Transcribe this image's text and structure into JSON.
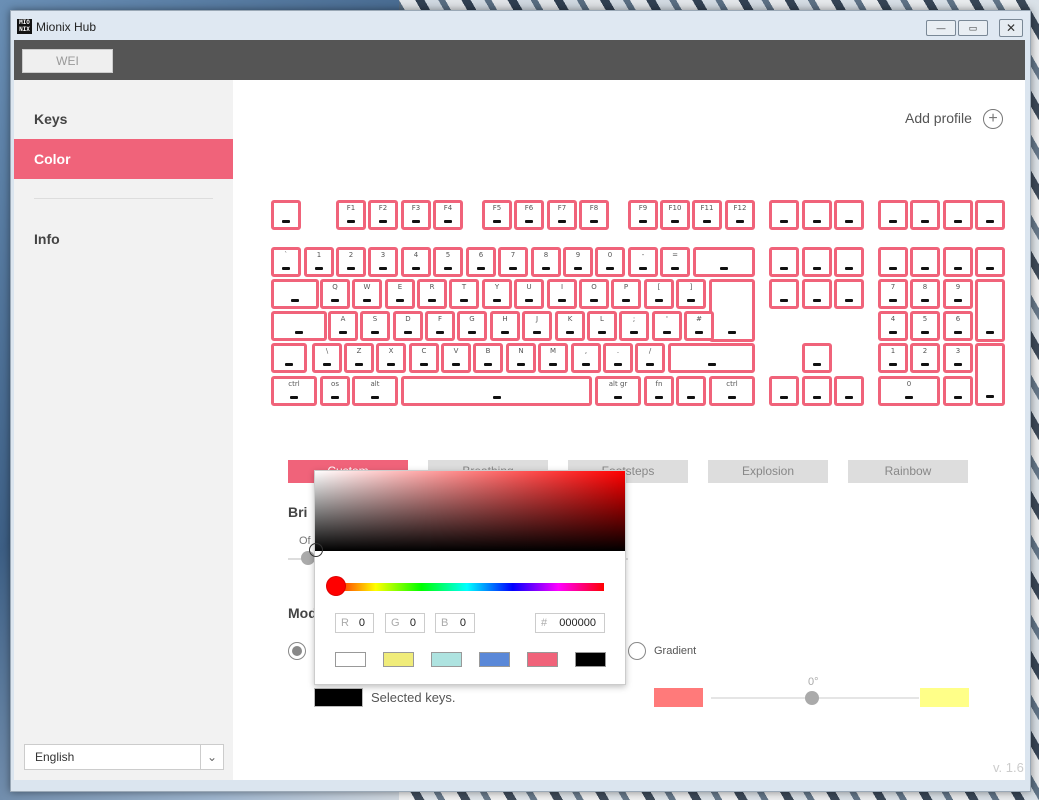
{
  "window": {
    "title": "Mionix Hub",
    "logo_text": "MIO NIX"
  },
  "toolbar": {
    "profile_tab": "WEI"
  },
  "sidebar": {
    "items": [
      {
        "label": "Keys",
        "active": false
      },
      {
        "label": "Color",
        "active": true
      },
      {
        "label": "Info",
        "active": false
      }
    ],
    "language": "English"
  },
  "main": {
    "add_profile": "Add profile",
    "effects": [
      "Custom",
      "Breathing",
      "Footsteps",
      "Explosion",
      "Rainbow"
    ],
    "active_effect": "Custom",
    "brightness_label": "Bri",
    "brightness_off": "Of",
    "mode_label": "Mod",
    "gradient_label": "Gradient",
    "selected_keys_label": "Selected keys.",
    "angle": "0°",
    "gradient_start_color": "#ff7a7a",
    "gradient_end_color": "#ffff88",
    "selected_color": "#000000",
    "version": "v. 1.6"
  },
  "keyboard": {
    "key_color": "#f0637a",
    "row_fn": [
      "",
      "F1",
      "F2",
      "F3",
      "F4",
      "F5",
      "F6",
      "F7",
      "F8",
      "F9",
      "F10",
      "F11",
      "F12",
      "",
      "",
      "",
      "",
      "",
      "",
      ""
    ],
    "row_num": [
      "`",
      "1",
      "2",
      "3",
      "4",
      "5",
      "6",
      "7",
      "8",
      "9",
      "0",
      "-",
      "=",
      "",
      "",
      "",
      "",
      "",
      "",
      "",
      ""
    ],
    "row_q": [
      "",
      "Q",
      "W",
      "E",
      "R",
      "T",
      "Y",
      "U",
      "I",
      "O",
      "P",
      "[",
      "]",
      "",
      "",
      "",
      "",
      "7",
      "8",
      "9",
      ""
    ],
    "row_a": [
      "",
      "A",
      "S",
      "D",
      "F",
      "G",
      "H",
      "J",
      "K",
      "L",
      ";",
      "'",
      "#",
      "4",
      "5",
      "6"
    ],
    "row_z": [
      "",
      "\\",
      "Z",
      "X",
      "C",
      "V",
      "B",
      "N",
      "M",
      ",",
      ".",
      "/",
      "",
      "",
      "1",
      "2",
      "3"
    ],
    "row_ctrl": [
      "ctrl",
      "os",
      "alt",
      "",
      "alt gr",
      "fn",
      "",
      "ctrl",
      "",
      "",
      "",
      "0",
      ""
    ]
  },
  "picker": {
    "r": "0",
    "g": "0",
    "b": "0",
    "hex": "000000",
    "r_label": "R",
    "g_label": "G",
    "b_label": "B",
    "hex_label": "#",
    "presets": [
      "#ffffff",
      "#f0ec7a",
      "#aee3e0",
      "#5a88d8",
      "#f0637a",
      "#000000"
    ]
  }
}
